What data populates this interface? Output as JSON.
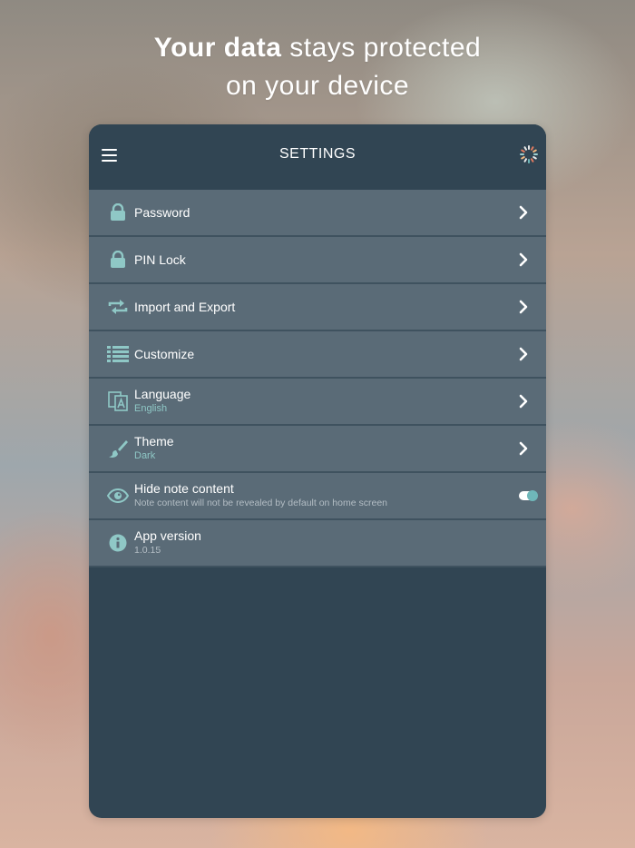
{
  "headline": {
    "bold": "Your data",
    "line1_rest": " stays protected",
    "line2": "on your device"
  },
  "appbar": {
    "title": "SETTINGS",
    "menu_icon": "hamburger-icon",
    "status_icon": "spinner-icon"
  },
  "settings": [
    {
      "title": "Password",
      "icon": "lock-icon"
    },
    {
      "title": "PIN Lock",
      "icon": "lock-icon"
    },
    {
      "title": "Import and Export",
      "icon": "import-export-icon"
    },
    {
      "title": "Customize",
      "icon": "list-icon"
    },
    {
      "title": "Language",
      "subtitle": "English",
      "icon": "translate-icon"
    },
    {
      "title": "Theme",
      "subtitle": "Dark",
      "icon": "brush-icon"
    },
    {
      "title": "Hide note content",
      "subtitle": "Note content will not be revealed by default on home screen",
      "icon": "eye-icon",
      "toggle": true
    },
    {
      "title": "App version",
      "subtitle": "1.0.15",
      "icon": "info-icon"
    }
  ],
  "colors": {
    "app_background": "#314553",
    "row_background": "#5a6b77",
    "accent": "#8fc8c6"
  }
}
